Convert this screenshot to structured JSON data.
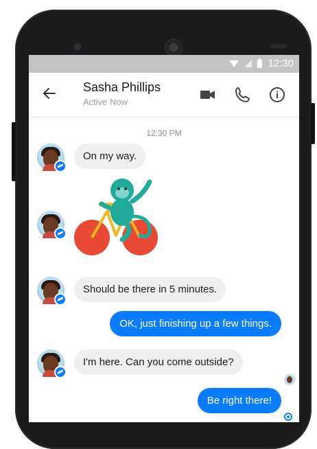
{
  "status_bar": {
    "time": "12:30"
  },
  "header": {
    "contact_name": "Sasha Phillips",
    "status": "Active Now",
    "icons": [
      "back-arrow-icon",
      "video-call-icon",
      "phone-icon",
      "info-icon"
    ]
  },
  "chat": {
    "timestamp": "12:30 PM",
    "messages": [
      {
        "from": "Sasha Phillips",
        "text": "On my way."
      },
      {
        "from": "Sasha Phillips",
        "sticker": "monkey-on-bicycle"
      },
      {
        "from": "Sasha Phillips",
        "text": "Should be there in 5 minutes."
      },
      {
        "from": "me",
        "text": "OK, just finishing up a few things."
      },
      {
        "from": "Sasha Phillips",
        "text": "I'm here. Can you come outside?"
      },
      {
        "from": "me",
        "text": "Be right there!"
      }
    ]
  },
  "colors": {
    "accent": "#0a7cff",
    "incoming_bubble": "#f1f0f0",
    "status_bar": "#c4c4c4",
    "phone_body": "#1b1b1d"
  }
}
